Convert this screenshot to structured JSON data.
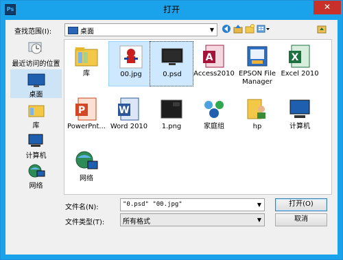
{
  "window": {
    "title": "打开",
    "app_icon_text": "Ps",
    "close_glyph": "✕"
  },
  "look_in": {
    "label": "查找范围(I):",
    "value": "桌面",
    "arrow": "▼"
  },
  "toolbar": {
    "back_glyph": "◀",
    "up_glyph": "▲",
    "new_folder_glyph": "✱",
    "views_glyph": "▤▾"
  },
  "sidebar": {
    "items": [
      {
        "label": "最近访问的位置",
        "icon": "recent-places-icon"
      },
      {
        "label": "桌面",
        "icon": "desktop-icon",
        "selected": true
      },
      {
        "label": "库",
        "icon": "libraries-icon"
      },
      {
        "label": "计算机",
        "icon": "computer-icon"
      },
      {
        "label": "网络",
        "icon": "network-icon"
      }
    ]
  },
  "files": [
    {
      "name": "库",
      "icon": "libraries-folder-icon"
    },
    {
      "name": "00.jpg",
      "icon": "spiderman-image-icon",
      "state": "selected"
    },
    {
      "name": "0.psd",
      "icon": "monitor-image-icon",
      "state": "focused"
    },
    {
      "name": "Access2010",
      "icon": "access-icon"
    },
    {
      "name": "EPSON File Manager",
      "icon": "epson-icon"
    },
    {
      "name": "Excel 2010",
      "icon": "excel-icon"
    },
    {
      "name": "PowerPnt...",
      "icon": "powerpoint-icon"
    },
    {
      "name": "Word 2010",
      "icon": "word-icon"
    },
    {
      "name": "1.png",
      "icon": "dark-image-icon"
    },
    {
      "name": "家庭组",
      "icon": "homegroup-icon"
    },
    {
      "name": "hp",
      "icon": "user-folder-icon"
    },
    {
      "name": "计算机",
      "icon": "computer-icon"
    },
    {
      "name": "网络",
      "icon": "network-icon"
    }
  ],
  "file_name": {
    "label": "文件名(N):",
    "value": "\"0.psd\" \"00.jpg\""
  },
  "file_type": {
    "label": "文件类型(T):",
    "value": "所有格式"
  },
  "buttons": {
    "open": "打开(O)",
    "cancel": "取消"
  },
  "colors": {
    "title_bar": "#1aa2ea",
    "close_button": "#c7312a",
    "selection": "#cde8ff"
  }
}
